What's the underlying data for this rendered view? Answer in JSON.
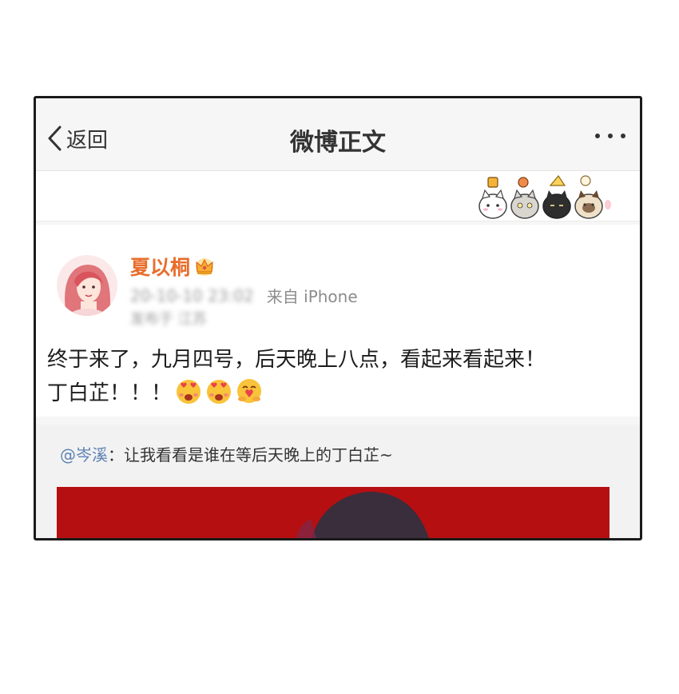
{
  "navbar": {
    "back_label": "返回",
    "title": "微博正文"
  },
  "post": {
    "username": "夏以桐",
    "source": "来自 iPhone",
    "timestamp_blurred": "20-10-10 23:02",
    "location_blurred": "发布于 江苏",
    "content_line1": "终于来了，九月四号，后天晚上八点，看起来看起来！",
    "content_line2": "丁白芷！！！"
  },
  "repost": {
    "mention": "@岑溪",
    "separator": "：",
    "text": "让我看看是谁在等后天晚上的丁白芷~"
  },
  "colors": {
    "username": "#e86d2b",
    "mention": "#5b82b3",
    "image_bg": "#b50f12"
  },
  "icons": [
    "chevron-left-icon",
    "more-icon",
    "crown-icon",
    "heart-eyes-emoji-icon",
    "hug-emoji-icon",
    "cats-banner-decoration"
  ]
}
